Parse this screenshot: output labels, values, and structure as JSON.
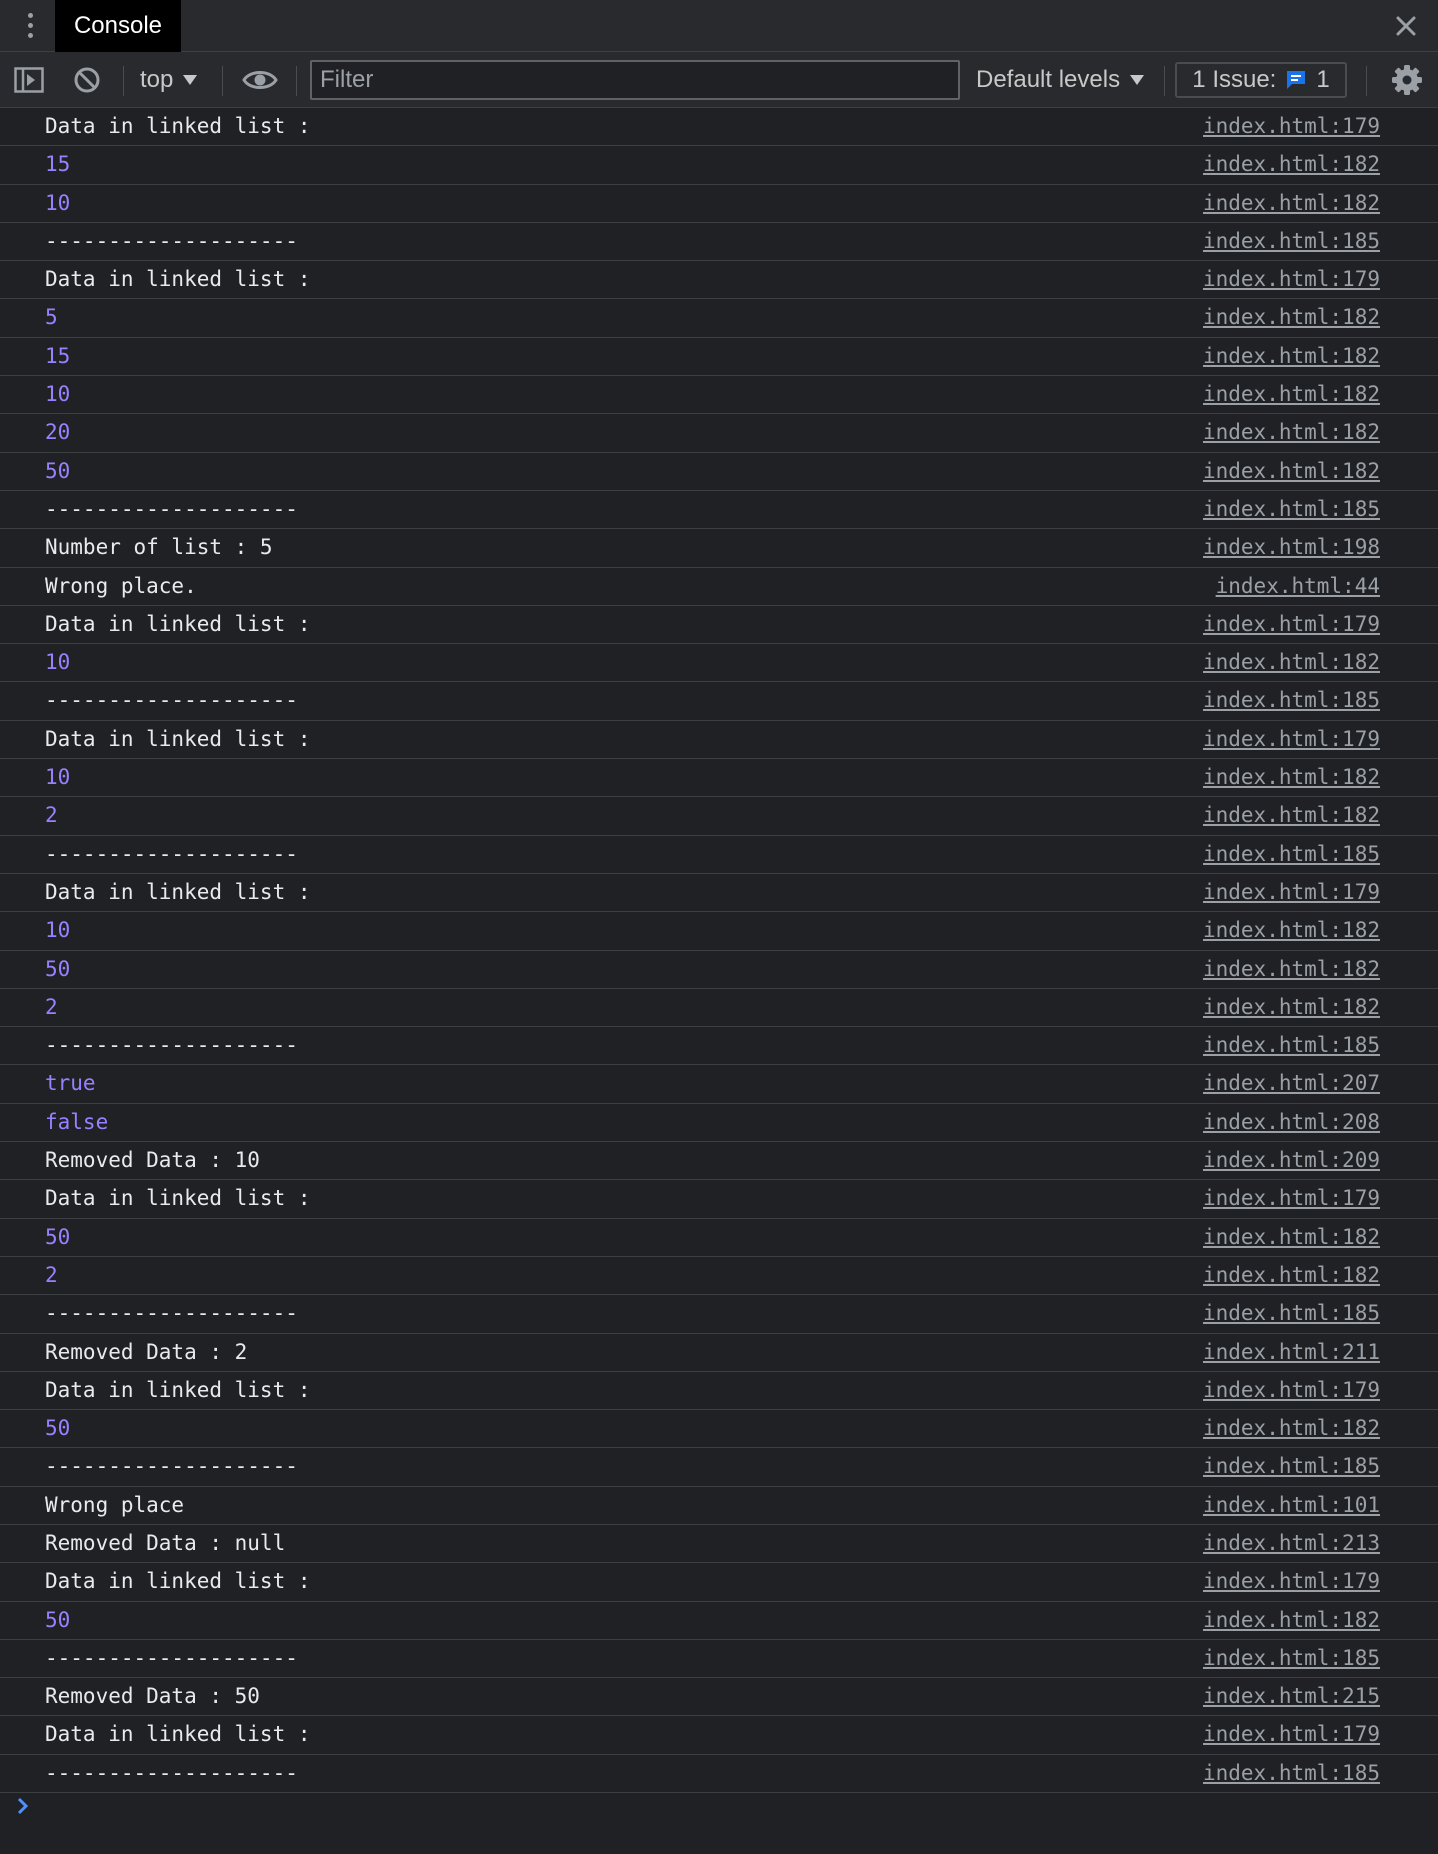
{
  "header": {
    "tab_label": "Console"
  },
  "toolbar": {
    "context": "top",
    "filter_placeholder": "Filter",
    "levels_label": "Default levels",
    "issues_label": "1 Issue:",
    "issues_count": "1"
  },
  "messages": [
    {
      "text": "Data in linked list :",
      "kind": "text",
      "source": "index.html:179"
    },
    {
      "text": "15",
      "kind": "number",
      "source": "index.html:182"
    },
    {
      "text": "10",
      "kind": "number",
      "source": "index.html:182"
    },
    {
      "text": "--------------------",
      "kind": "text",
      "source": "index.html:185"
    },
    {
      "text": "Data in linked list :",
      "kind": "text",
      "source": "index.html:179"
    },
    {
      "text": "5",
      "kind": "number",
      "source": "index.html:182"
    },
    {
      "text": "15",
      "kind": "number",
      "source": "index.html:182"
    },
    {
      "text": "10",
      "kind": "number",
      "source": "index.html:182"
    },
    {
      "text": "20",
      "kind": "number",
      "source": "index.html:182"
    },
    {
      "text": "50",
      "kind": "number",
      "source": "index.html:182"
    },
    {
      "text": "--------------------",
      "kind": "text",
      "source": "index.html:185"
    },
    {
      "text": "Number of list : 5",
      "kind": "text",
      "source": "index.html:198"
    },
    {
      "text": "Wrong place.",
      "kind": "text",
      "source": "index.html:44"
    },
    {
      "text": "Data in linked list :",
      "kind": "text",
      "source": "index.html:179"
    },
    {
      "text": "10",
      "kind": "number",
      "source": "index.html:182"
    },
    {
      "text": "--------------------",
      "kind": "text",
      "source": "index.html:185"
    },
    {
      "text": "Data in linked list :",
      "kind": "text",
      "source": "index.html:179"
    },
    {
      "text": "10",
      "kind": "number",
      "source": "index.html:182"
    },
    {
      "text": "2",
      "kind": "number",
      "source": "index.html:182"
    },
    {
      "text": "--------------------",
      "kind": "text",
      "source": "index.html:185"
    },
    {
      "text": "Data in linked list :",
      "kind": "text",
      "source": "index.html:179"
    },
    {
      "text": "10",
      "kind": "number",
      "source": "index.html:182"
    },
    {
      "text": "50",
      "kind": "number",
      "source": "index.html:182"
    },
    {
      "text": "2",
      "kind": "number",
      "source": "index.html:182"
    },
    {
      "text": "--------------------",
      "kind": "text",
      "source": "index.html:185"
    },
    {
      "text": "true",
      "kind": "number",
      "source": "index.html:207"
    },
    {
      "text": "false",
      "kind": "number",
      "source": "index.html:208"
    },
    {
      "text": "Removed Data : 10",
      "kind": "text",
      "source": "index.html:209"
    },
    {
      "text": "Data in linked list :",
      "kind": "text",
      "source": "index.html:179"
    },
    {
      "text": "50",
      "kind": "number",
      "source": "index.html:182"
    },
    {
      "text": "2",
      "kind": "number",
      "source": "index.html:182"
    },
    {
      "text": "--------------------",
      "kind": "text",
      "source": "index.html:185"
    },
    {
      "text": "Removed Data : 2",
      "kind": "text",
      "source": "index.html:211"
    },
    {
      "text": "Data in linked list :",
      "kind": "text",
      "source": "index.html:179"
    },
    {
      "text": "50",
      "kind": "number",
      "source": "index.html:182"
    },
    {
      "text": "--------------------",
      "kind": "text",
      "source": "index.html:185"
    },
    {
      "text": "Wrong place",
      "kind": "text",
      "source": "index.html:101"
    },
    {
      "text": "Removed Data : null",
      "kind": "text",
      "source": "index.html:213"
    },
    {
      "text": "Data in linked list :",
      "kind": "text",
      "source": "index.html:179"
    },
    {
      "text": "50",
      "kind": "number",
      "source": "index.html:182"
    },
    {
      "text": "--------------------",
      "kind": "text",
      "source": "index.html:185"
    },
    {
      "text": "Removed Data : 50",
      "kind": "text",
      "source": "index.html:215"
    },
    {
      "text": "Data in linked list :",
      "kind": "text",
      "source": "index.html:179"
    },
    {
      "text": "--------------------",
      "kind": "text",
      "source": "index.html:185"
    }
  ],
  "colors": {
    "background": "#202124",
    "toolbar": "#292a2d",
    "number_value": "#9980ff",
    "link": "#9aa0a6",
    "issue_icon": "#1a73e8",
    "prompt": "#4d90fe"
  },
  "icons": {
    "menu": "kebab-icon",
    "close": "close-icon",
    "sidebar": "sidebar-toggle-icon",
    "clear": "clear-console-icon",
    "eye": "eye-icon",
    "issue": "chat-bubble-icon",
    "settings": "gear-icon",
    "prompt": "chevron-right-icon"
  }
}
